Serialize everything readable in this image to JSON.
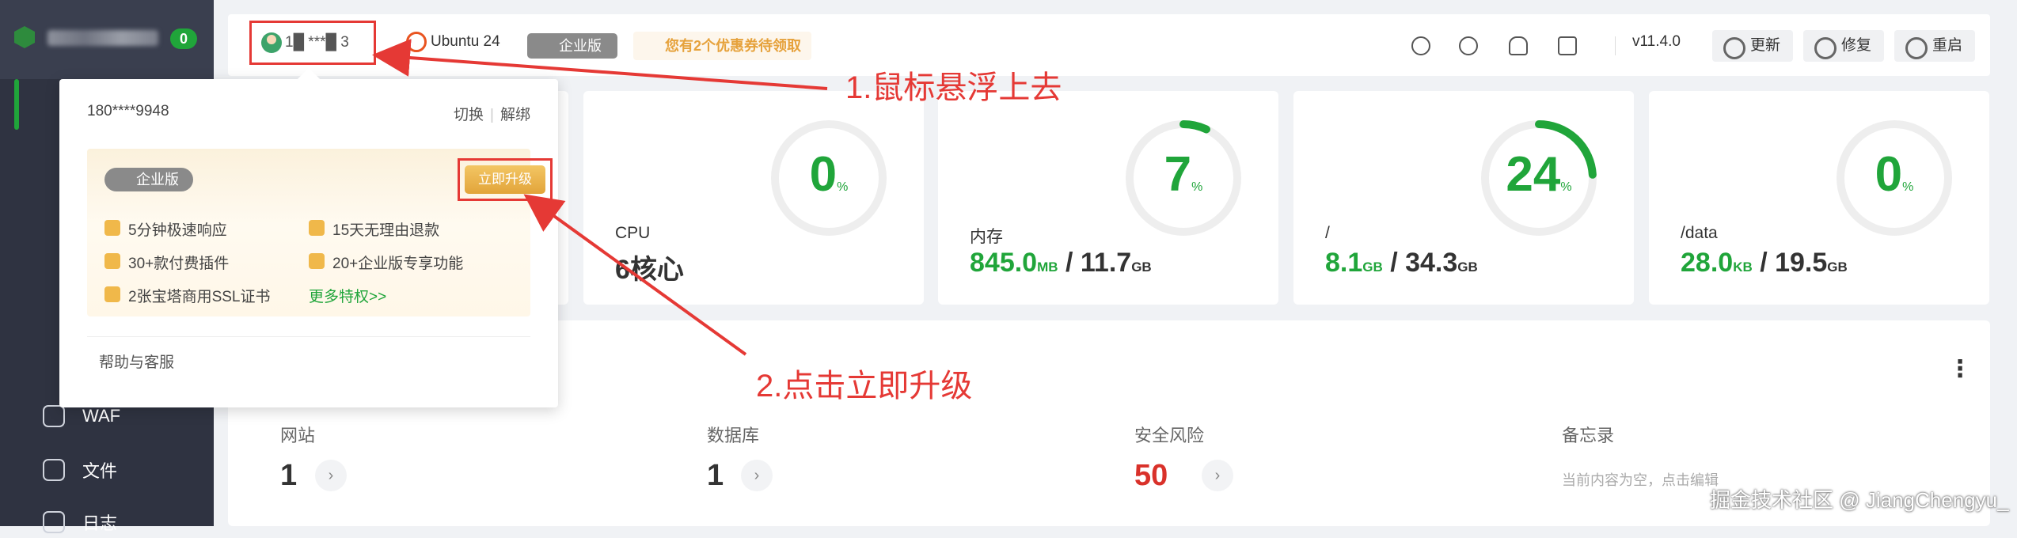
{
  "sidebar": {
    "badge": "0",
    "items": [
      {
        "label": "WAF"
      },
      {
        "label": "文件"
      },
      {
        "label": "日志"
      }
    ]
  },
  "header": {
    "user_masked": "1█ ***█ 3",
    "os": "Ubuntu 24",
    "edition": "企业版",
    "coupon": "您有2个优惠券待领取",
    "version": "v11.4.0",
    "buttons": {
      "update": "更新",
      "repair": "修复",
      "restart": "重启"
    },
    "icons": [
      "sun-icon",
      "palette-icon",
      "bell-icon",
      "note-icon"
    ]
  },
  "cards": [
    {
      "value": "0",
      "unit": "%",
      "label": "CPU",
      "main": "6核心",
      "sub_num": "",
      "sub_unit": "",
      "total_num": "",
      "total_unit": "",
      "percent": 0
    },
    {
      "value": "7",
      "unit": "%",
      "label": "内存",
      "main": "",
      "sub_num": "845.0",
      "sub_unit": "MB",
      "total_num": "11.7",
      "total_unit": "GB",
      "percent": 7
    },
    {
      "value": "24",
      "unit": "%",
      "label": "/",
      "main": "",
      "sub_num": "8.1",
      "sub_unit": "GB",
      "total_num": "34.3",
      "total_unit": "GB",
      "percent": 24
    },
    {
      "value": "0",
      "unit": "%",
      "label": "/data",
      "main": "",
      "sub_num": "28.0",
      "sub_unit": "KB",
      "total_num": "19.5",
      "total_unit": "GB",
      "percent": 0
    }
  ],
  "overview": {
    "sites": {
      "label": "网站",
      "value": "1"
    },
    "db": {
      "label": "数据库",
      "value": "1"
    },
    "risk": {
      "label": "安全风险",
      "value": "50"
    },
    "memo": {
      "label": "备忘录",
      "text": "当前内容为空，点击编辑"
    }
  },
  "popover": {
    "phone": "180****9948",
    "switch": "切换",
    "unbind": "解绑",
    "edition": "企业版",
    "upgrade": "立即升级",
    "features": [
      "5分钟极速响应",
      "15天无理由退款",
      "30+款付费插件",
      "20+企业版专享功能",
      "2张宝塔商用SSL证书"
    ],
    "more": "更多特权>>",
    "help": "帮助与客服"
  },
  "annotations": {
    "step1": "1.鼠标悬浮上去",
    "step2": "2.点击立即升级"
  },
  "watermark": "掘金技术社区 @ JiangChengyu_",
  "colors": {
    "accent": "#20a53a",
    "annotation": "#e53935",
    "gold": "#e6a23c",
    "risk": "#d9312a"
  }
}
